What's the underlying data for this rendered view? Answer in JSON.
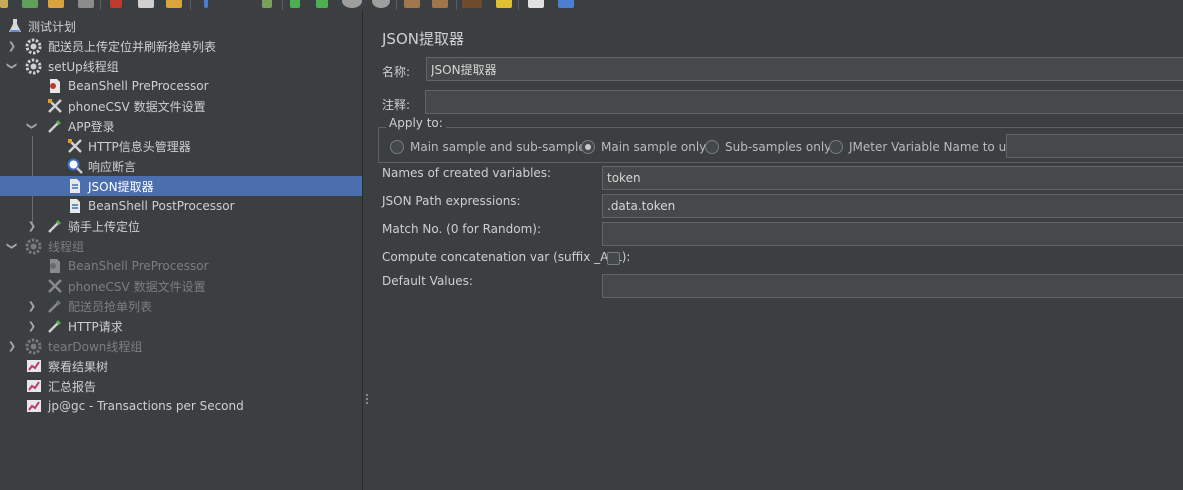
{
  "tree": {
    "items": [
      {
        "label": "测试计划",
        "icon": "test-plan-icon"
      },
      {
        "label": "配送员上传定位并刷新抢单列表",
        "icon": "thread-group-gear-icon"
      },
      {
        "label": "setUp线程组",
        "icon": "thread-group-gear-icon"
      },
      {
        "label": "BeanShell PreProcessor",
        "icon": "preprocessor-icon"
      },
      {
        "label": "phoneCSV 数据文件设置",
        "icon": "config-element-icon"
      },
      {
        "label": "APP登录",
        "icon": "sampler-pipette-icon"
      },
      {
        "label": "HTTP信息头管理器",
        "icon": "config-element-icon"
      },
      {
        "label": "响应断言",
        "icon": "assertion-magnifier-icon"
      },
      {
        "label": "JSON提取器",
        "icon": "postprocessor-icon"
      },
      {
        "label": "BeanShell PostProcessor",
        "icon": "postprocessor-icon"
      },
      {
        "label": "骑手上传定位",
        "icon": "sampler-pipette-icon"
      },
      {
        "label": "线程组",
        "icon": "thread-group-gear-icon"
      },
      {
        "label": "BeanShell PreProcessor",
        "icon": "preprocessor-icon"
      },
      {
        "label": "phoneCSV 数据文件设置",
        "icon": "config-element-icon"
      },
      {
        "label": "配送员抢单列表",
        "icon": "sampler-pipette-icon"
      },
      {
        "label": "HTTP请求",
        "icon": "sampler-pipette-icon"
      },
      {
        "label": "tearDown线程组",
        "icon": "thread-group-gear-icon"
      },
      {
        "label": "察看结果树",
        "icon": "listener-chart-icon"
      },
      {
        "label": "汇总报告",
        "icon": "listener-chart-icon"
      },
      {
        "label": "jp@gc - Transactions per Second",
        "icon": "listener-chart-icon"
      }
    ]
  },
  "form": {
    "title": "JSON提取器",
    "name_label": "名称:",
    "name_value": "JSON提取器",
    "comment_label": "注释:",
    "comment_value": "",
    "apply_to": {
      "legend": "Apply to:",
      "options": [
        {
          "label": "Main sample and sub-samples",
          "checked": false
        },
        {
          "label": "Main sample only",
          "checked": true
        },
        {
          "label": "Sub-samples only",
          "checked": false
        },
        {
          "label": "JMeter Variable Name to use",
          "checked": false
        }
      ],
      "variable_name_value": ""
    },
    "variables_label": "Names of created variables:",
    "variables_value": "token",
    "json_path_label": "JSON Path expressions:",
    "json_path_value": ".data.token",
    "match_no_label": "Match No. (0 for Random):",
    "match_no_value": "",
    "concat_label": "Compute concatenation var (suffix _ALL):",
    "concat_checked": false,
    "default_label": "Default Values:",
    "default_value": ""
  },
  "colors": {
    "background": "#3c3f41",
    "selection": "#4b6eaf",
    "input_background": "#45494a"
  }
}
